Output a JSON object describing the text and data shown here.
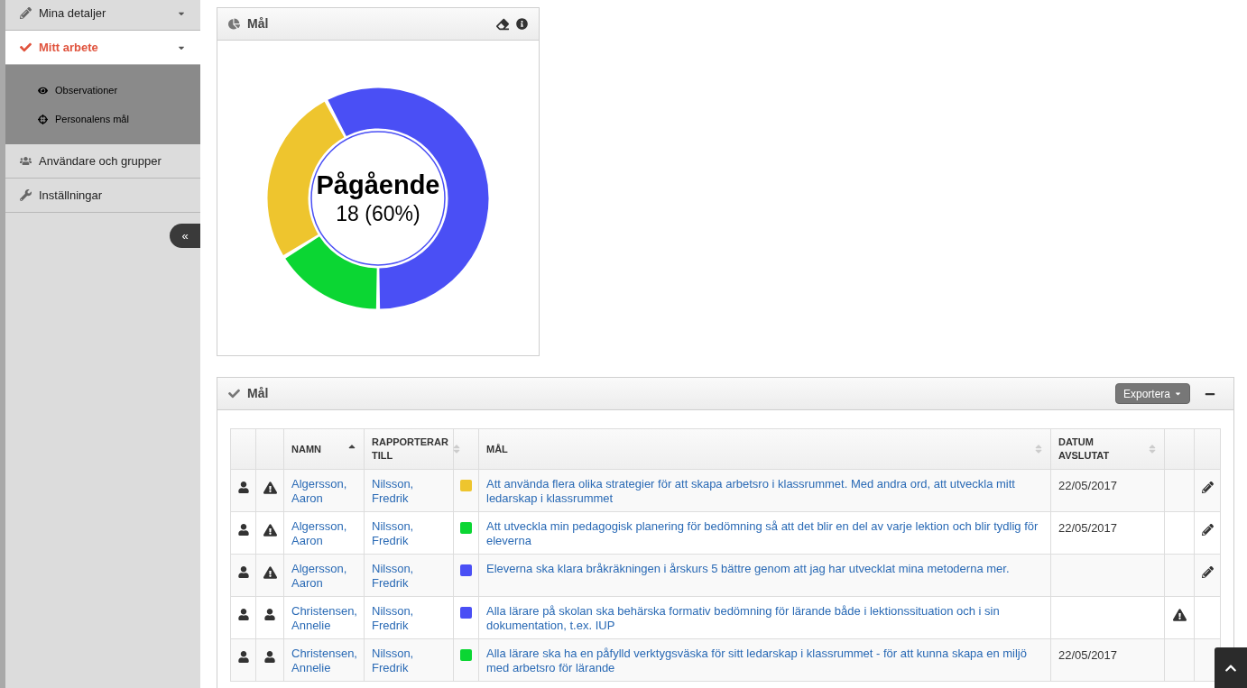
{
  "sidebar": {
    "items": [
      {
        "label": "Mina detaljer",
        "kind": "pencil",
        "selected": false,
        "expanded": false
      },
      {
        "label": "Mitt arbete",
        "kind": "check",
        "selected": true,
        "expanded": true,
        "children": [
          {
            "label": "Observationer",
            "kind": "eye"
          },
          {
            "label": "Personalens mål",
            "kind": "crosshair"
          }
        ]
      },
      {
        "label": "Användare och grupper",
        "kind": "users",
        "selected": false
      },
      {
        "label": "Inställningar",
        "kind": "wrench",
        "selected": false
      }
    ],
    "collapse_button": "«"
  },
  "chart_panel": {
    "title": "Mål",
    "center_label": "Pågående",
    "center_value": "18 (60%)"
  },
  "goals_panel": {
    "title": "Mål",
    "export_button": "Exportera",
    "table": {
      "columns": [
        {
          "label": "NAMN",
          "sorted": true
        },
        {
          "label": "RAPPORTERAR TILL",
          "sorted": false
        },
        {
          "label": "MÅL",
          "sorted": false
        },
        {
          "label": "DATUM AVSLUTAT",
          "sorted": false
        }
      ],
      "rows": [
        {
          "kind": "warning",
          "name": "Algersson, Aaron",
          "reports_to": "Nilsson, Fredrik",
          "color": "#eec52e",
          "goal": "Att använda flera olika strategier för att skapa arbetsro i klassrummet. Med andra ord, att utveckla mitt ledarskap i klassrummet",
          "date": "22/05/2017",
          "flagged": false,
          "editable": true
        },
        {
          "kind": "warning",
          "name": "Algersson, Aaron",
          "reports_to": "Nilsson, Fredrik",
          "color": "#0bd633",
          "goal": "Att utveckla min pedagogisk planering för bedömning så att det blir en del av varje lektion och blir tydlig för eleverna",
          "date": "22/05/2017",
          "flagged": false,
          "editable": true
        },
        {
          "kind": "warning",
          "name": "Algersson, Aaron",
          "reports_to": "Nilsson, Fredrik",
          "color": "#4a4ff5",
          "goal": "Eleverna ska klara bråkräkningen i årskurs 5 bättre genom att jag har utvecklat mina metoderna mer.",
          "flagged": false,
          "editable": true
        },
        {
          "kind": "person",
          "name": "Christensen, Annelie",
          "reports_to": "Nilsson, Fredrik",
          "color": "#4a4ff5",
          "goal": "Alla lärare på skolan ska behärska formativ bedömning för lärande både i lektionssituation och i sin dokumentation, t.ex. IUP",
          "flagged": true,
          "editable": false
        },
        {
          "kind": "person",
          "name": "Christensen, Annelie",
          "reports_to": "Nilsson, Fredrik",
          "color": "#0bd633",
          "goal": "Alla lärare ska ha en påfylld verktygsväska för sitt ledarskap i klassrummet - för att kunna skapa en miljö med arbetsro för lärande",
          "date": "22/05/2017",
          "flagged": false,
          "editable": false
        }
      ]
    }
  }
}
